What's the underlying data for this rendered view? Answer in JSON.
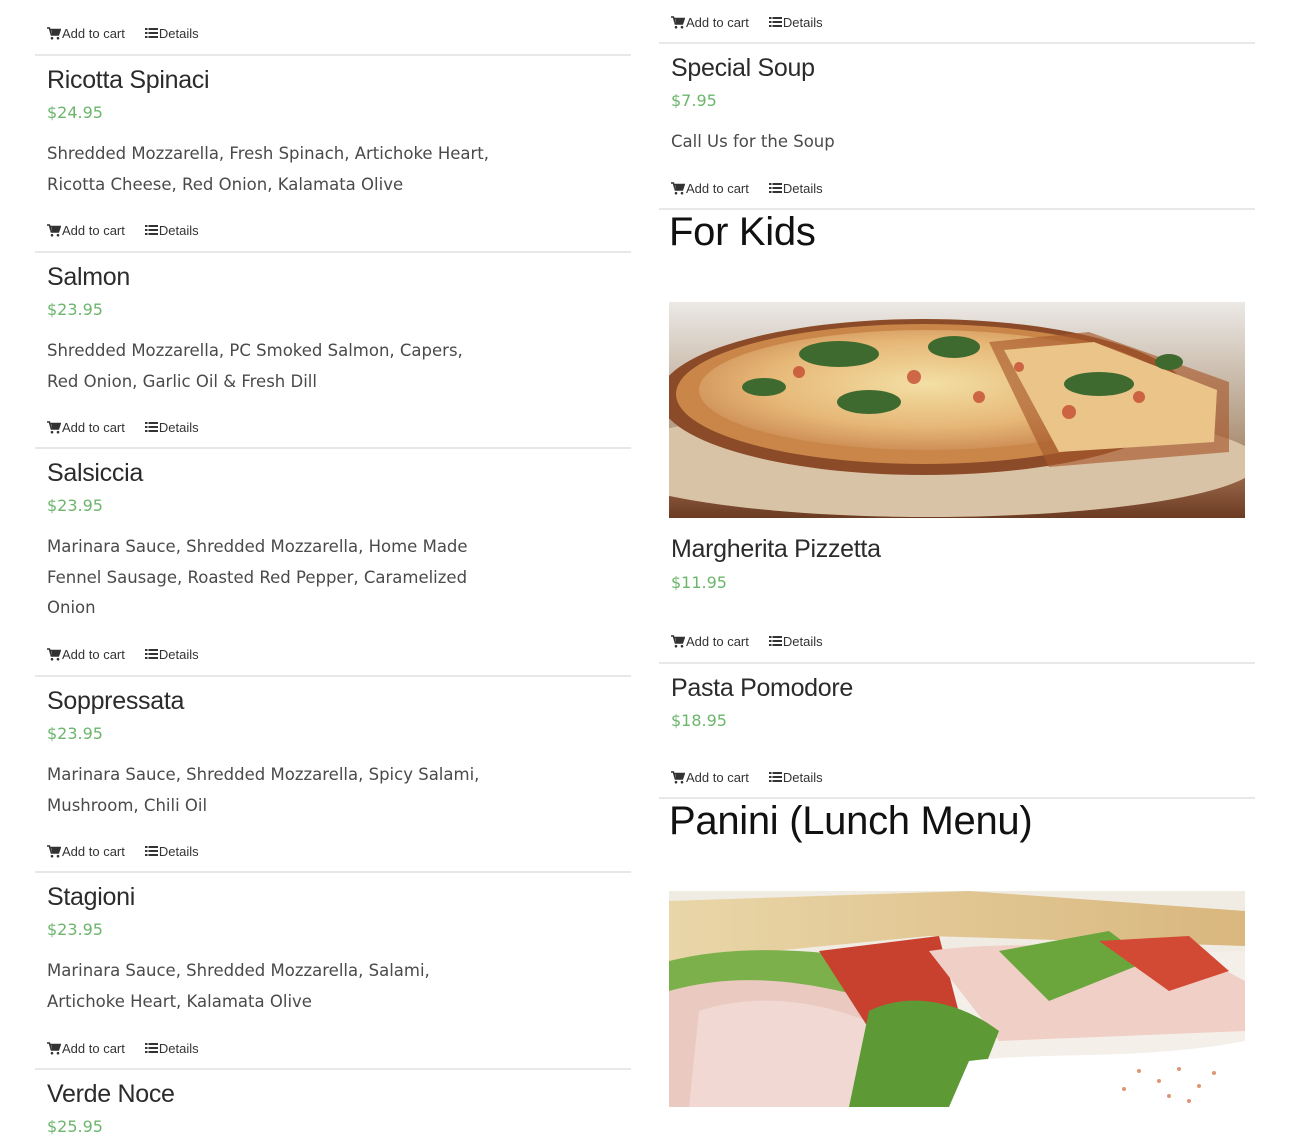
{
  "actions": {
    "add_to_cart": "Add to cart",
    "details": "Details"
  },
  "left_column": {
    "items": [
      {
        "name": "",
        "price": "",
        "description": ""
      },
      {
        "name": "Ricotta Spinaci",
        "price": "$24.95",
        "description": "Shredded Mozzarella, Fresh Spinach, Artichoke Heart, Ricotta Cheese, Red Onion, Kalamata Olive"
      },
      {
        "name": "Salmon",
        "price": "$23.95",
        "description": "Shredded Mozzarella, PC Smoked Salmon, Capers, Red Onion, Garlic Oil & Fresh Dill"
      },
      {
        "name": "Salsiccia",
        "price": "$23.95",
        "description": "Marinara Sauce, Shredded Mozzarella, Home Made Fennel Sausage, Roasted Red Pepper, Caramelized Onion"
      },
      {
        "name": "Soppressata",
        "price": "$23.95",
        "description": "Marinara Sauce, Shredded Mozzarella, Spicy Salami, Mushroom, Chili Oil"
      },
      {
        "name": "Stagioni",
        "price": "$23.95",
        "description": "Marinara Sauce, Shredded Mozzarella, Salami, Artichoke Heart, Kalamata Olive"
      },
      {
        "name": "Verde Noce",
        "price": "$25.95",
        "description": ""
      }
    ]
  },
  "right_column": {
    "special_soup": {
      "name": "Special Soup",
      "price": "$7.95",
      "description": "Call Us for the Soup"
    },
    "for_kids": {
      "title": "For Kids",
      "image": "pizza-photo",
      "items": [
        {
          "name": "Margherita Pizzetta",
          "price": "$11.95"
        },
        {
          "name": "Pasta Pomodore",
          "price": "$18.95"
        }
      ]
    },
    "panini": {
      "title": "Panini (Lunch Menu)",
      "image": "sandwich-photo"
    }
  },
  "colors": {
    "price": "#6cb66c",
    "divider": "#e8e8e8",
    "title": "#111111"
  },
  "icons": {
    "cart": "cart-icon",
    "details": "list-icon"
  }
}
